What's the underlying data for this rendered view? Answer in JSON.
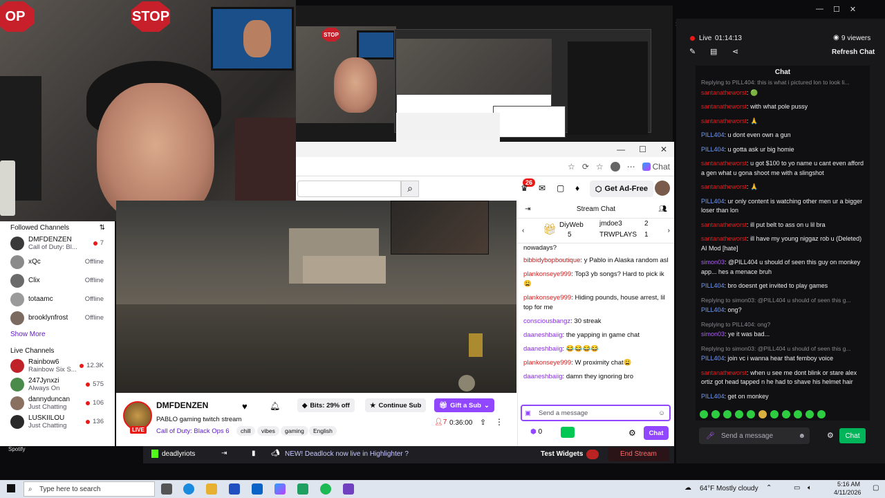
{
  "webcam": {
    "stop_sign": "STOP"
  },
  "twitch_header": {
    "notification_count": "26",
    "ad_free_label": "Get Ad-Free",
    "copilot_chat_label": "Chat"
  },
  "sidebar": {
    "followed_title": "Followed Channels",
    "followed": [
      {
        "name": "DMFDENZEN",
        "sub": "Call of Duty: Bl...",
        "status": "7",
        "live": true,
        "color": "#3a3a3a"
      },
      {
        "name": "xQc",
        "sub": "",
        "status": "Offline",
        "live": false,
        "color": "#8a8a8a"
      },
      {
        "name": "Clix",
        "sub": "",
        "status": "Offline",
        "live": false,
        "color": "#6a6a6a"
      },
      {
        "name": "totaamc",
        "sub": "",
        "status": "Offline",
        "live": false,
        "color": "#9a9a9a"
      },
      {
        "name": "brooklynfrost",
        "sub": "",
        "status": "Offline",
        "live": false,
        "color": "#7a6a60"
      }
    ],
    "show_more": "Show More",
    "live_title": "Live Channels",
    "live": [
      {
        "name": "Rainbow6",
        "sub": "Rainbow Six S...",
        "status": "12.3K",
        "color": "#c0222a"
      },
      {
        "name": "247Jynxzi",
        "sub": "Always On",
        "status": "575",
        "color": "#4a8a4a"
      },
      {
        "name": "dannyduncan",
        "sub": "Just Chatting",
        "status": "106",
        "color": "#8a7060"
      },
      {
        "name": "LUSKIILOU",
        "sub": "Just Chatting",
        "status": "136",
        "color": "#2a2a2a"
      }
    ]
  },
  "stream": {
    "channel": "DMFDENZEN",
    "title": "PABLO gaming twitch stream",
    "game": "Call of Duty: Black Ops 6",
    "tags": [
      "chill",
      "vibes",
      "gaming",
      "English"
    ],
    "live_badge": "LIVE",
    "bits_label": "Bits: 29% off",
    "continue_sub": "Continue Sub",
    "gift_sub": "Gift a Sub",
    "viewers": "7",
    "uptime": "0:36:00"
  },
  "twitch_chat": {
    "title": "Stream Chat",
    "gifters": [
      {
        "name": "DiyWeb",
        "count": "5"
      },
      {
        "name": "jmdoe3",
        "count": "2"
      },
      {
        "name": "TRWPLAYS",
        "count": "1"
      }
    ],
    "partial_top": "nowadays?",
    "messages": [
      {
        "user": "bibbidybopboutique",
        "color": "#b22222",
        "text": "y Pablo in Alaska random asl"
      },
      {
        "user": "plankonseye999",
        "color": "#d41c1c",
        "text": "Top3 yb songs? Hard to pick ik😩"
      },
      {
        "user": "plankonseye999",
        "color": "#d41c1c",
        "text": "Hiding pounds, house arrest, lil top for me"
      },
      {
        "user": "consciousbangz",
        "color": "#8a2be2",
        "text": "30 streak"
      },
      {
        "user": "daaneshbaiig",
        "color": "#8a2be2",
        "text": "the yapping in game chat"
      },
      {
        "user": "daaneshbaiig",
        "color": "#8a2be2",
        "text": "😂😂😂😂"
      },
      {
        "user": "plankonseye999",
        "color": "#d41c1c",
        "text": "W proximity chat😩"
      },
      {
        "user": "daaneshbaiig",
        "color": "#8a2be2",
        "text": "damn they ignoring bro"
      }
    ],
    "input_placeholder": "Send a message",
    "points": "0",
    "chat_button": "Chat"
  },
  "obs": {
    "spotify_label": "Spotify",
    "streamer": "deadlyriots",
    "notice": "NEW! Deadlock now live in Highlighter ?",
    "test_widgets": "Test Widgets",
    "end_stream": "End Stream"
  },
  "right_panel": {
    "live_label": "Live",
    "timer": "01:14:13",
    "viewers": "9 viewers",
    "refresh": "Refresh Chat",
    "chat_title": "Chat",
    "messages": [
      {
        "reply": "Replying to PILL404: this is what i pictured lon to look li...",
        "user": "santanatheworst",
        "color": "#e02020",
        "text": "🟢"
      },
      {
        "reply": "",
        "user": "santanatheworst",
        "color": "#e02020",
        "text": "with what pole pussy"
      },
      {
        "reply": "",
        "user": "santanatheworst",
        "color": "#e02020",
        "text": "🙏"
      },
      {
        "reply": "",
        "user": "PILL404",
        "color": "#6f9bff",
        "text": "u dont even own a gun"
      },
      {
        "reply": "",
        "user": "PILL404",
        "color": "#6f9bff",
        "text": "u gotta ask ur big homie"
      },
      {
        "reply": "",
        "user": "santanatheworst",
        "color": "#e02020",
        "text": "u got $100 to yo name u cant even afford a gen what u gona shoot me with a slingshot"
      },
      {
        "reply": "",
        "user": "santanatheworst",
        "color": "#e02020",
        "text": "🙏"
      },
      {
        "reply": "",
        "user": "PILL404",
        "color": "#6f9bff",
        "text": "ur only content is watching other men ur a bigger loser than lon"
      },
      {
        "reply": "",
        "user": "santanatheworst",
        "color": "#e02020",
        "text": "ill put belt to ass on u lil bra"
      },
      {
        "reply": "",
        "user": "santanatheworst",
        "color": "#e02020",
        "text": "ill have my young niggaz rob u (Deleted) AI Mod [hate]"
      },
      {
        "reply": "",
        "user": "simon03",
        "color": "#b05cff",
        "text": "@PILL404 u should of seen this guy on monkey app... hes a menace bruh"
      },
      {
        "reply": "",
        "user": "PILL404",
        "color": "#6f9bff",
        "text": "bro doesnt get invited to play games"
      },
      {
        "reply": "Replying to simon03: @PILL404 u should of seen this g...",
        "user": "PILL404",
        "color": "#6f9bff",
        "text": "ong?"
      },
      {
        "reply": "Replying to PILL404: ong?",
        "user": "simon03",
        "color": "#b05cff",
        "text": "ye it was bad..."
      },
      {
        "reply": "Replying to simon03: @PILL404 u should of seen this g...",
        "user": "PILL404",
        "color": "#6f9bff",
        "text": "join vc i wanna hear that femboy voice"
      },
      {
        "reply": "",
        "user": "santanatheworst",
        "color": "#e02020",
        "text": "when u see me dont blink or stare alex ortiz got head tapped n he had to shave his helmet hair"
      },
      {
        "reply": "",
        "user": "PILL404",
        "color": "#6f9bff",
        "text": "get on monkey"
      }
    ],
    "input_placeholder": "Send a message",
    "chat_button": "Chat"
  },
  "taskbar": {
    "search_placeholder": "Type here to search",
    "weather": "64°F  Mostly cloudy",
    "time": "5:16 AM",
    "date": "4/11/2026"
  }
}
